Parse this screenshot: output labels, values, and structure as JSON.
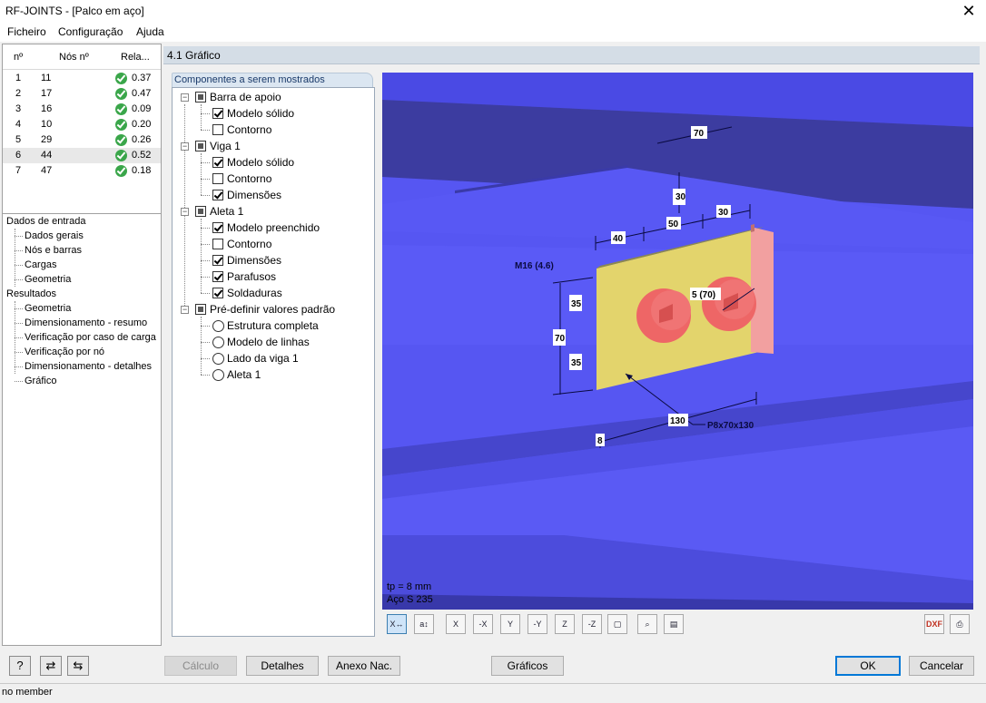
{
  "window": {
    "title": "RF-JOINTS - [Palco em aço]"
  },
  "menu": {
    "file": "Ficheiro",
    "config": "Configuração",
    "help": "Ajuda"
  },
  "nodes_table": {
    "headers": {
      "no": "nº",
      "node": "Nós nº",
      "ratio": "Rela..."
    },
    "rows": [
      {
        "no": "1",
        "node": "11",
        "ratio": "0.37"
      },
      {
        "no": "2",
        "node": "17",
        "ratio": "0.47"
      },
      {
        "no": "3",
        "node": "16",
        "ratio": "0.09"
      },
      {
        "no": "4",
        "node": "10",
        "ratio": "0.20"
      },
      {
        "no": "5",
        "node": "29",
        "ratio": "0.26"
      },
      {
        "no": "6",
        "node": "44",
        "ratio": "0.52"
      },
      {
        "no": "7",
        "node": "47",
        "ratio": "0.18"
      }
    ],
    "selected_index": 5
  },
  "nav_tree": {
    "input_group": "Dados de entrada",
    "input_items": [
      "Dados gerais",
      "Nós e barras",
      "Cargas",
      "Geometria"
    ],
    "results_group": "Resultados",
    "results_items": [
      "Geometria",
      "Dimensionamento - resumo",
      "Verificação por caso de carga",
      "Verificação por nó",
      "Dimensionamento - detalhes",
      "Gráfico"
    ]
  },
  "panel": {
    "title": "4.1 Gráfico"
  },
  "components": {
    "header": "Componentes a serem mostrados",
    "groups": [
      {
        "label": "Barra de apoio",
        "items": [
          {
            "label": "Modelo sólido",
            "checked": true
          },
          {
            "label": "Contorno",
            "checked": false
          }
        ]
      },
      {
        "label": "Viga 1",
        "items": [
          {
            "label": "Modelo sólido",
            "checked": true
          },
          {
            "label": "Contorno",
            "checked": false
          },
          {
            "label": "Dimensões",
            "checked": true
          }
        ]
      },
      {
        "label": "Aleta 1",
        "items": [
          {
            "label": "Modelo preenchido",
            "checked": true
          },
          {
            "label": "Contorno",
            "checked": false
          },
          {
            "label": "Dimensões",
            "checked": true
          },
          {
            "label": "Parafusos",
            "checked": true
          },
          {
            "label": "Soldaduras",
            "checked": true
          }
        ]
      },
      {
        "label": "Pré-definir valores padrão",
        "items": [
          {
            "label": "Estrutura completa"
          },
          {
            "label": "Modelo de linhas"
          },
          {
            "label": "Lado da viga 1"
          },
          {
            "label": "Aleta 1"
          }
        ]
      }
    ]
  },
  "graphic": {
    "dims": {
      "d70_top": "70",
      "d30_v": "30",
      "d40": "40",
      "d50": "50",
      "d30_h": "30",
      "d35_a": "35",
      "d70_v": "70",
      "d35_b": "35",
      "d130": "130",
      "d8": "8",
      "d5_70": "5 (70)"
    },
    "labels": {
      "bolt": "M16 (4.6)",
      "plate": "P8x70x130"
    },
    "info_line1": "tp = 8 mm",
    "info_line2": "Aço S 235",
    "colors": {
      "background": "#5454f0",
      "plate": "#e3d46c",
      "bolt": "#ee6666",
      "weld": "#f2a0a0"
    }
  },
  "toolbar_icons": [
    "view-x-icon",
    "view-iso-icon",
    "view-x-dir-icon",
    "view-neg-x-icon",
    "view-y-icon",
    "view-neg-y-icon",
    "view-z-icon",
    "view-neg-z-icon",
    "box-view-icon",
    "zoom-all-icon",
    "display-options-icon",
    "dxf-export-icon",
    "print-icon"
  ],
  "buttons": {
    "calc": "Cálculo",
    "details": "Detalhes",
    "annex": "Anexo Nac.",
    "graphics": "Gráficos",
    "ok": "OK",
    "cancel": "Cancelar"
  },
  "status": {
    "text": "no member"
  }
}
